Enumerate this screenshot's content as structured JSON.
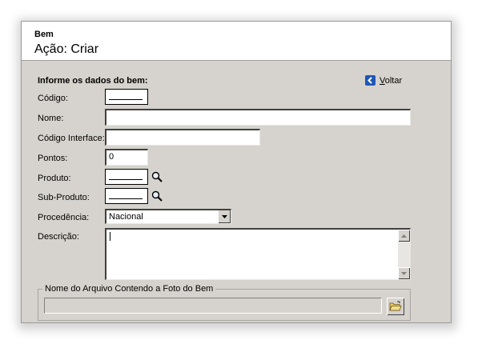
{
  "header": {
    "subtitle": "Bem",
    "title": "Ação: Criar"
  },
  "form": {
    "section_title": "Informe os dados do bem:",
    "back_label_first": "V",
    "back_label_rest": "oltar",
    "codigo_label": "Código:",
    "nome_label": "Nome:",
    "codigo_interface_label": "Código Interface:",
    "pontos_label": "Pontos:",
    "pontos_value": "0",
    "produto_label": "Produto:",
    "subproduto_label": "Sub-Produto:",
    "procedencia_label": "Procedência:",
    "procedencia_value": "Nacional",
    "descricao_label": "Descrição:",
    "foto_legend": "Nome do Arquivo Contendo a Foto do Bem"
  },
  "icons": {
    "back": "chevron-left-icon",
    "search": "magnifier-icon",
    "browse": "open-folder-icon",
    "dropdown": "triangle-down-icon"
  },
  "colors": {
    "window_bg": "#d6d3ce",
    "back_icon": "#1f57b8"
  }
}
